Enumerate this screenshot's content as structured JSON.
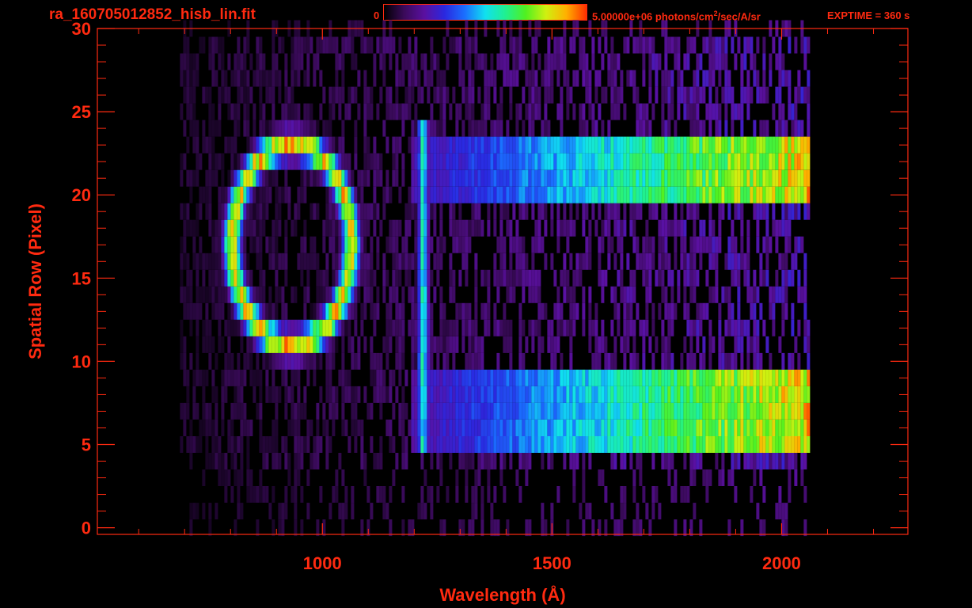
{
  "header": {
    "file_title": "ra_160705012852_hisb_lin.fit",
    "colorbar_min": "0",
    "colorbar_max_prefix": "5.00000e+06 photons/cm",
    "colorbar_max_sup": "2",
    "colorbar_max_suffix": "/sec/A/sr",
    "exptime": "EXPTIME = 360 s"
  },
  "colors": {
    "axis": "#ff2a10",
    "background": "#000000",
    "colormap": [
      "#000000",
      "#3a0a5a",
      "#5a10a0",
      "#2a28e0",
      "#1a70ff",
      "#10e0f0",
      "#20f090",
      "#50f020",
      "#d0f010",
      "#ffb000",
      "#ff3000"
    ]
  },
  "chart_data": {
    "type": "heatmap",
    "title": "",
    "xlabel": "Wavelength (Å)",
    "ylabel": "Spatial Row (Pixel)",
    "xlim": [
      510,
      2275
    ],
    "ylim": [
      -0.4,
      30
    ],
    "x_ticks": [
      1000,
      1500,
      2000
    ],
    "x_minor_ticks": [
      600,
      700,
      800,
      900,
      1100,
      1200,
      1300,
      1400,
      1600,
      1700,
      1800,
      1900,
      2100,
      2200
    ],
    "y_ticks": [
      0,
      5,
      10,
      15,
      20,
      25,
      30
    ],
    "y_minor_ticks": [
      1,
      2,
      3,
      4,
      6,
      7,
      8,
      9,
      11,
      12,
      13,
      14,
      16,
      17,
      18,
      19,
      21,
      22,
      23,
      24,
      26,
      27,
      28,
      29
    ],
    "grid": false,
    "colorbar": {
      "min": 0,
      "max": 5000000,
      "units": "photons/cm^2/sec/A/sr"
    },
    "spectral_coverage": [
      690,
      2060
    ],
    "features": [
      {
        "kind": "ring",
        "center_wavelength": 930,
        "center_row": 17,
        "wl_radius": 130,
        "row_radius": 6,
        "peak_fraction": 0.85
      },
      {
        "kind": "band",
        "rows": [
          20,
          23
        ],
        "wavelength_range": [
          1190,
          2060
        ],
        "peak_fraction": 0.85
      },
      {
        "kind": "band",
        "rows": [
          5,
          9
        ],
        "wavelength_range": [
          1190,
          2060
        ],
        "peak_fraction": 0.85
      },
      {
        "kind": "line",
        "wavelength": 1216,
        "rows": [
          5,
          24
        ],
        "peak_fraction": 0.6
      }
    ]
  }
}
